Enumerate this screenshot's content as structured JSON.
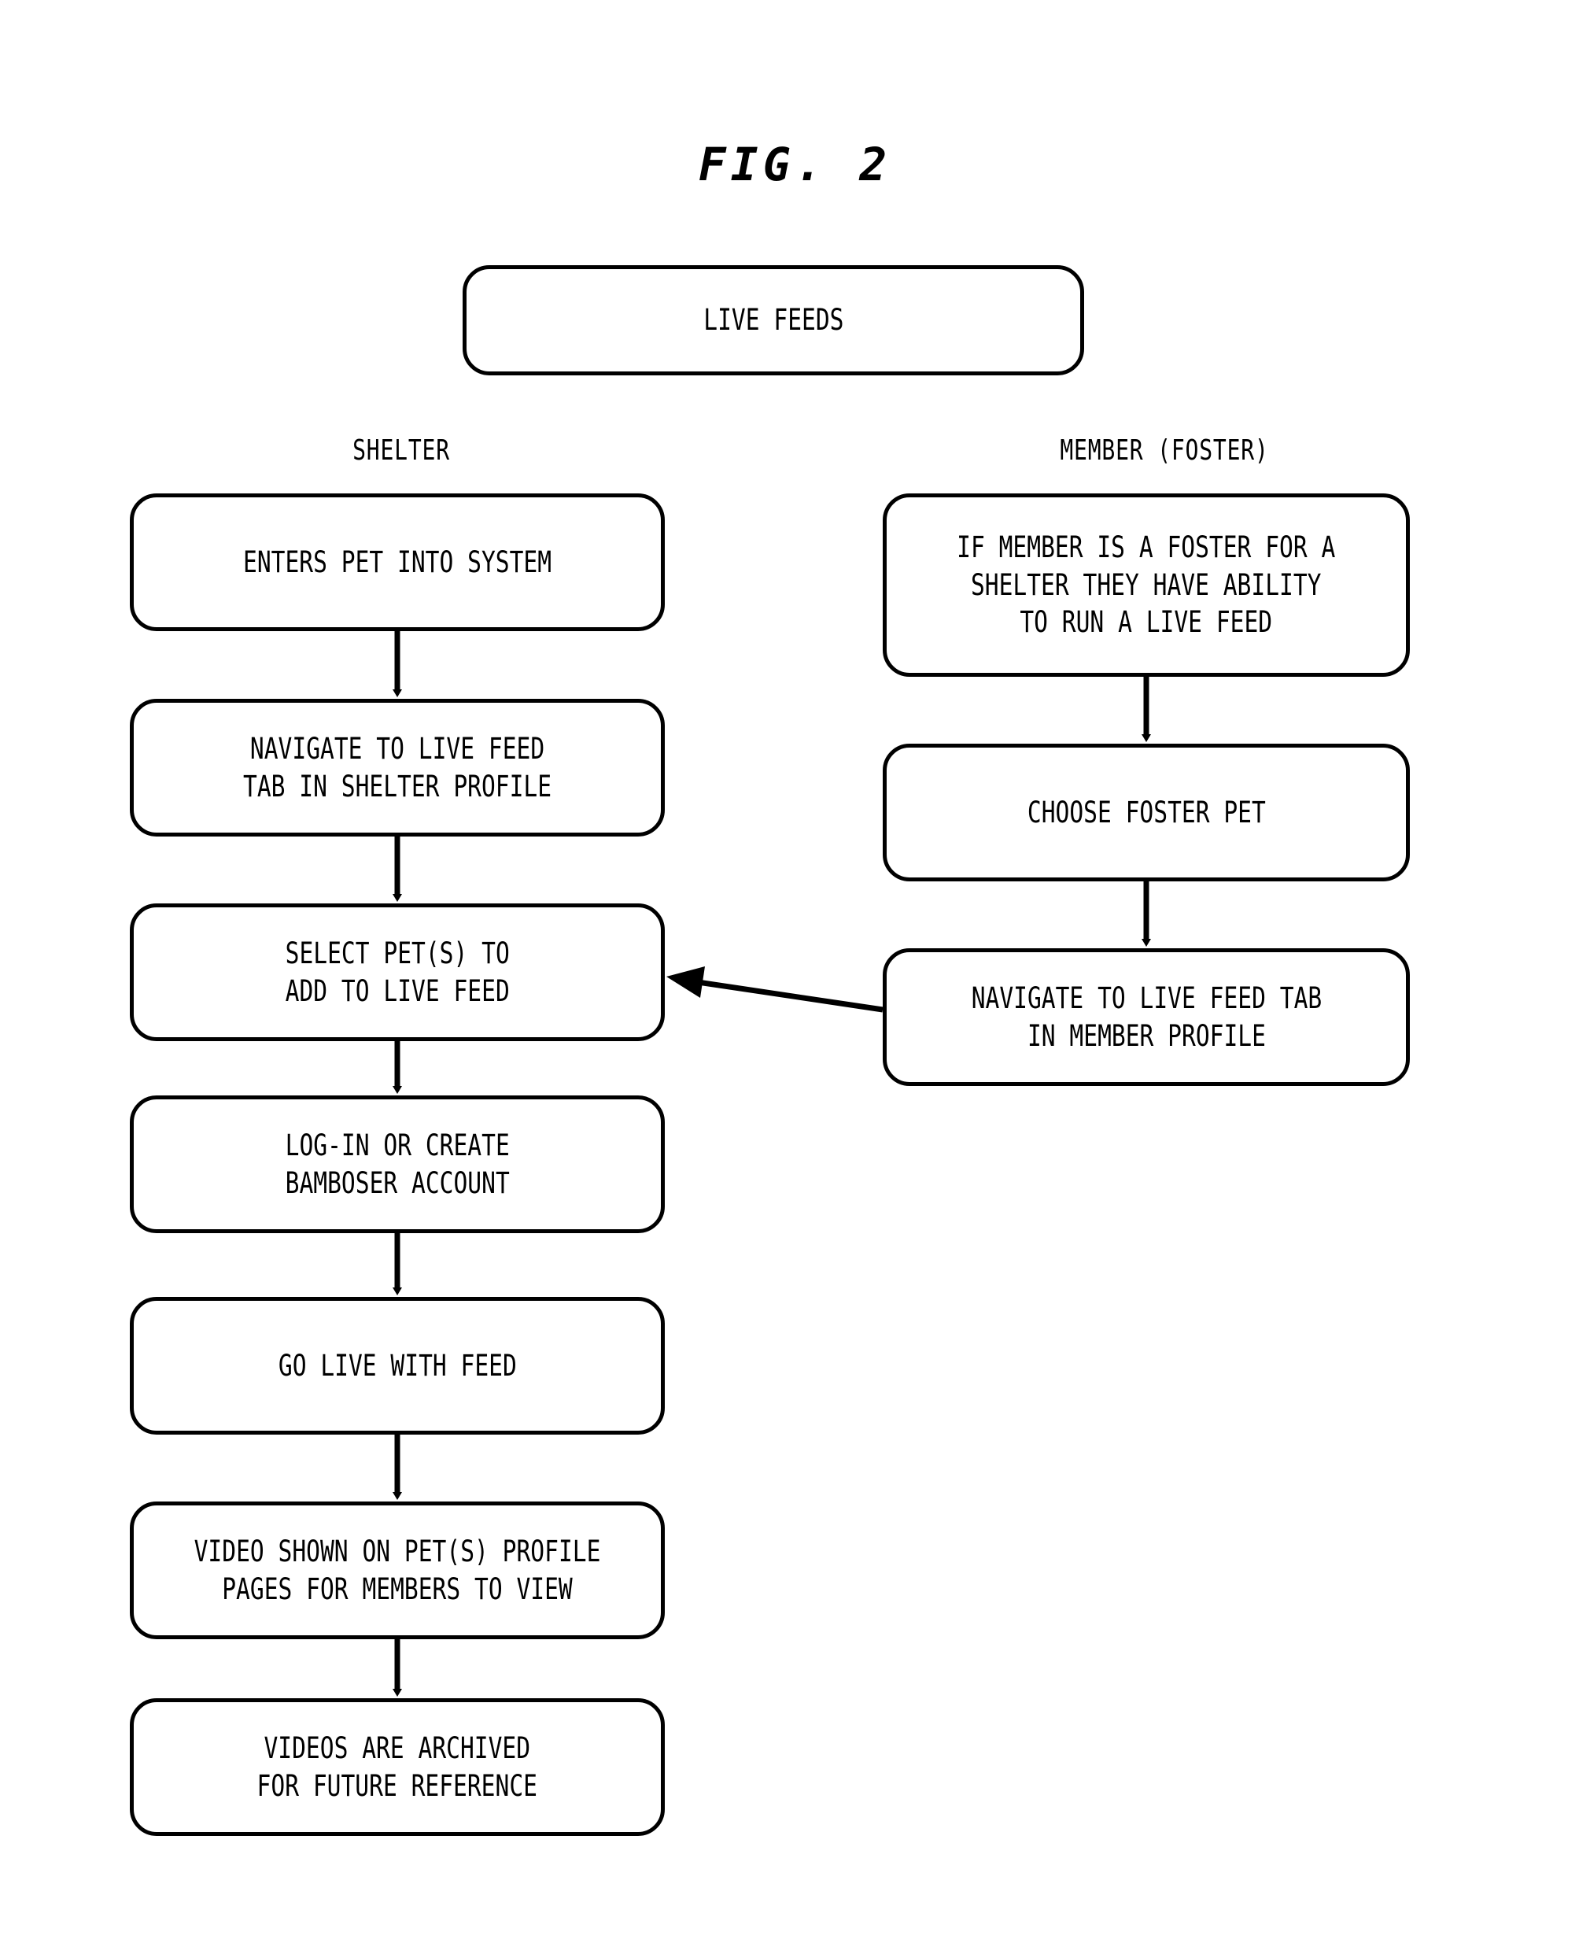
{
  "figure": {
    "title": "FIG. 2",
    "line_color": "#000000",
    "background_color": "#ffffff"
  },
  "root_node": {
    "label": "LIVE FEEDS"
  },
  "columns": [
    {
      "id": "shelter",
      "label": "SHELTER"
    },
    {
      "id": "member",
      "label": "MEMBER (FOSTER)"
    }
  ],
  "shelter_nodes": [
    {
      "id": "enters-pet-into-system",
      "label": "ENTERS PET INTO SYSTEM"
    },
    {
      "id": "navigate-live-feed-tab-shelter",
      "label": "NAVIGATE TO LIVE FEED\nTAB IN SHELTER PROFILE"
    },
    {
      "id": "select-pets-to-add",
      "label": "SELECT PET(S) TO\nADD TO LIVE FEED"
    },
    {
      "id": "log-in-or-create-account",
      "label": "LOG-IN OR CREATE\nBAMBOSER ACCOUNT"
    },
    {
      "id": "go-live-with-feed",
      "label": "GO LIVE WITH FEED"
    },
    {
      "id": "video-shown-on-profile",
      "label": "VIDEO SHOWN ON PET(S) PROFILE\nPAGES FOR MEMBERS TO VIEW"
    },
    {
      "id": "videos-are-archived",
      "label": "VIDEOS ARE ARCHIVED\nFOR FUTURE REFERENCE"
    }
  ],
  "member_nodes": [
    {
      "id": "if-member-is-foster",
      "label": "IF MEMBER IS A FOSTER FOR A\nSHELTER THEY HAVE ABILITY\nTO RUN A LIVE FEED"
    },
    {
      "id": "choose-foster-pet",
      "label": "CHOOSE FOSTER PET"
    },
    {
      "id": "navigate-live-feed-tab-member",
      "label": "NAVIGATE TO LIVE FEED TAB\nIN MEMBER PROFILE"
    }
  ],
  "connectors": [
    {
      "id": "shelter-1-to-2",
      "from": "enters-pet-into-system",
      "to": "navigate-live-feed-tab-shelter",
      "direction": "down"
    },
    {
      "id": "shelter-2-to-3",
      "from": "navigate-live-feed-tab-shelter",
      "to": "select-pets-to-add",
      "direction": "down"
    },
    {
      "id": "shelter-3-to-4",
      "from": "select-pets-to-add",
      "to": "log-in-or-create-account",
      "direction": "down"
    },
    {
      "id": "shelter-4-to-5",
      "from": "log-in-or-create-account",
      "to": "go-live-with-feed",
      "direction": "down"
    },
    {
      "id": "shelter-5-to-6",
      "from": "go-live-with-feed",
      "to": "video-shown-on-profile",
      "direction": "down"
    },
    {
      "id": "shelter-6-to-7",
      "from": "video-shown-on-profile",
      "to": "videos-are-archived",
      "direction": "down"
    },
    {
      "id": "member-1-to-2",
      "from": "if-member-is-foster",
      "to": "choose-foster-pet",
      "direction": "down"
    },
    {
      "id": "member-2-to-3",
      "from": "choose-foster-pet",
      "to": "navigate-live-feed-tab-member",
      "direction": "down"
    },
    {
      "id": "member-3-to-shelter-3",
      "from": "navigate-live-feed-tab-member",
      "to": "select-pets-to-add",
      "direction": "left"
    }
  ]
}
